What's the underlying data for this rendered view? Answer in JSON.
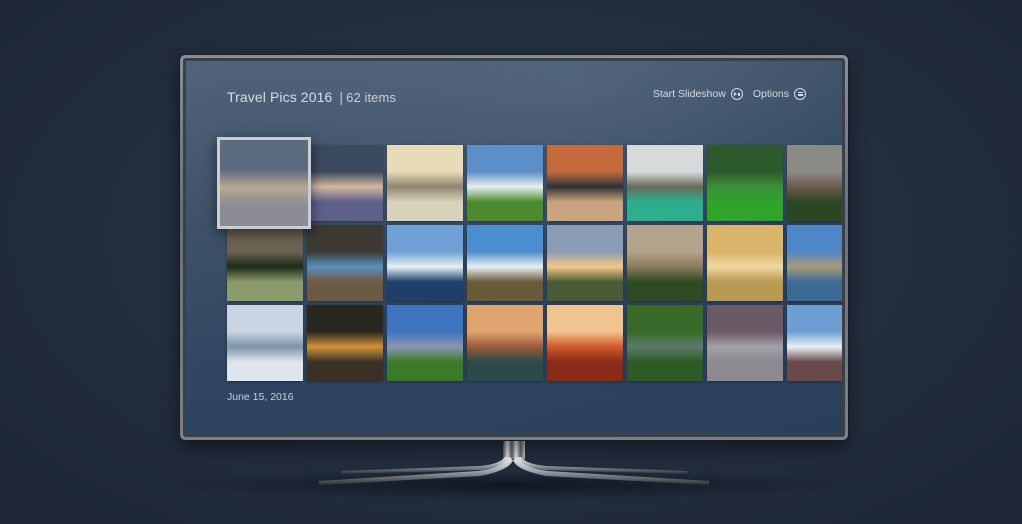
{
  "album": {
    "title": "Travel Pics 2016",
    "separator": "|",
    "count_label": "62 items"
  },
  "actions": {
    "slideshow_label": "Start Slideshow",
    "slideshow_icon": "play-circle-icon",
    "options_label": "Options",
    "options_icon": "menu-circle-icon"
  },
  "date_label": "June 15, 2016",
  "selected_index": 0,
  "colors": {
    "screen_bg": "#3f5269",
    "text": "#d6dde6",
    "selection_border": "#c9ced4",
    "room_bg": "#212c3c"
  },
  "photos": [
    {
      "name": "beach-rocks-cloudy-sunset",
      "sky": "#5d6b80",
      "mid": "#b9a793",
      "ground": "#8c8d94"
    },
    {
      "name": "calm-sea-dusk",
      "sky": "#3c4a5f",
      "mid": "#d3b7a0",
      "ground": "#5f5f8c"
    },
    {
      "name": "halong-bay-boat-sepia",
      "sky": "#e7dbb9",
      "mid": "#8f8670",
      "ground": "#d9d2bb"
    },
    {
      "name": "wind-turbines-green-hills",
      "sky": "#5c8fc8",
      "mid": "#e8eef4",
      "ground": "#4d8a2f"
    },
    {
      "name": "rocky-shore-orange-sky",
      "sky": "#c46a3c",
      "mid": "#2e3136",
      "ground": "#c9a47e"
    },
    {
      "name": "junk-boat-emerald-water",
      "sky": "#d6dadb",
      "mid": "#6a6a5a",
      "ground": "#2fae8e"
    },
    {
      "name": "forest-path",
      "sky": "#2d5a2d",
      "mid": "#3f8f39",
      "ground": "#2fa32c"
    },
    {
      "name": "cliff-forest",
      "sky": "#8a8a86",
      "mid": "#6f5b4d",
      "ground": "#2a4722"
    },
    {
      "name": "palm-rice-terraces",
      "sky": "#6c6354",
      "mid": "#1c2a18",
      "ground": "#8c9b6c"
    },
    {
      "name": "blue-rocky-coast",
      "sky": "#3d3a33",
      "mid": "#5a8fbd",
      "ground": "#6d5a45"
    },
    {
      "name": "frosted-tree-lake",
      "sky": "#6fa0d6",
      "mid": "#e8eef5",
      "ground": "#1d3f6a"
    },
    {
      "name": "three-sisters-clouds",
      "sky": "#4d8ed0",
      "mid": "#e9eef4",
      "ground": "#6a5a3a"
    },
    {
      "name": "coastal-sunset-hill",
      "sky": "#8a9cb5",
      "mid": "#f3c88a",
      "ground": "#4a5a35"
    },
    {
      "name": "zhangjiajie-pillars",
      "sky": "#b3a28c",
      "mid": "#8c7a5c",
      "ground": "#2e4a22"
    },
    {
      "name": "golden-fields-cypress",
      "sky": "#d9b46a",
      "mid": "#f0d8a0",
      "ground": "#b89a55"
    },
    {
      "name": "lighthouse-rocky-shore",
      "sky": "#4f86c7",
      "mid": "#a89a7a",
      "ground": "#3d6a94"
    },
    {
      "name": "misty-forest",
      "sky": "#c9d5e2",
      "mid": "#7d93a8",
      "ground": "#dfe5ec"
    },
    {
      "name": "lake-trees-sunset",
      "sky": "#2a2620",
      "mid": "#d0923a",
      "ground": "#3a3025"
    },
    {
      "name": "mountain-meadow",
      "sky": "#3f74c0",
      "mid": "#8a96b0",
      "ground": "#3c7a2a"
    },
    {
      "name": "horseshoe-bend",
      "sky": "#e0a470",
      "mid": "#9a5a3a",
      "ground": "#2d4a4a"
    },
    {
      "name": "antelope-canyon",
      "sky": "#f0c490",
      "mid": "#d0582a",
      "ground": "#8a2a18"
    },
    {
      "name": "japanese-garden-bridge",
      "sky": "#3a6a2a",
      "mid": "#5c7a6a",
      "ground": "#2e5a25"
    },
    {
      "name": "pier-long-exposure",
      "sky": "#6a5a66",
      "mid": "#a3a0a8",
      "ground": "#8c8a90"
    },
    {
      "name": "stone-tower-heather",
      "sky": "#6e9fd4",
      "mid": "#eaf0f5",
      "ground": "#6a4a4a"
    }
  ]
}
